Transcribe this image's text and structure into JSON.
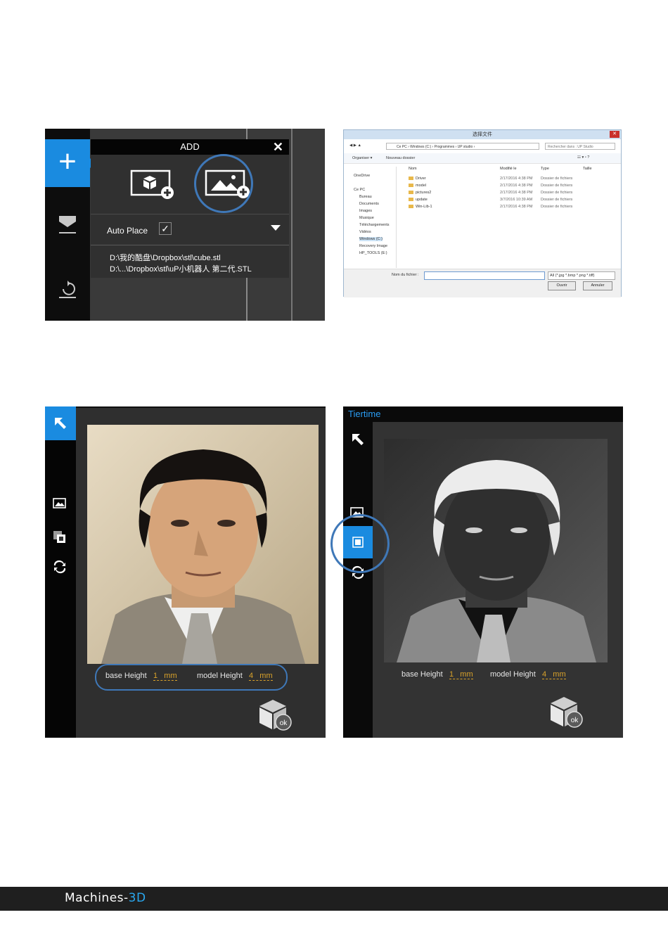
{
  "add_panel": {
    "title": "ADD",
    "close_label": "✕",
    "auto_place_label": "Auto Place",
    "auto_place_checked": true,
    "recent_files": [
      "D:\\我的酷盘\\Dropbox\\stl\\cube.stl",
      "D:\\...\\Dropbox\\stl\\uP小机器人 第二代.STL"
    ],
    "icons": [
      "add-model-icon",
      "add-image-icon",
      "layers-icon",
      "reset-icon"
    ]
  },
  "file_dialog": {
    "title": "选择文件",
    "breadcrumb": "Ce PC  ›  Windows (C:)  ›  Programmes  ›  UP studio  ›",
    "search_placeholder": "Rechercher dans : UP Studio",
    "organize_label": "Organiser ▾",
    "new_folder_label": "Nouveau dossier",
    "columns": [
      "Nom",
      "Modifié le",
      "Type",
      "Taille"
    ],
    "rows": [
      {
        "name": "Driver",
        "date": "2/17/2016 4:38 PM",
        "type": "Dossier de fichiers"
      },
      {
        "name": "model",
        "date": "2/17/2016 4:38 PM",
        "type": "Dossier de fichiers"
      },
      {
        "name": "pictures2",
        "date": "2/17/2016 4:38 PM",
        "type": "Dossier de fichiers"
      },
      {
        "name": "update",
        "date": "3/7/2016 10:39 AM",
        "type": "Dossier de fichiers"
      },
      {
        "name": "Win-Lib-1",
        "date": "2/17/2016 4:38 PM",
        "type": "Dossier de fichiers"
      }
    ],
    "nav_items": [
      "OneDrive",
      "Ce PC",
      "Bureau",
      "Documents",
      "Images",
      "Musique",
      "Téléchargements",
      "Vidéos",
      "Windows (C:)",
      "Recovery Image",
      "HP_TOOLS (E:)"
    ],
    "filename_label": "Nom du fichier :",
    "filetype_value": "All (*.jpg *.bmp *.png *.tiff)",
    "open_label": "Ouvrir",
    "cancel_label": "Annuler"
  },
  "image_panel_left": {
    "base_height_label": "base Height",
    "base_height_value": "1",
    "base_height_unit": "mm",
    "model_height_label": "model Height",
    "model_height_value": "4",
    "model_height_unit": "mm",
    "ok_label": "ok"
  },
  "image_panel_right": {
    "brand": "Tiertime",
    "base_height_label": "base Height",
    "base_height_value": "1",
    "base_height_unit": "mm",
    "model_height_label": "model Height",
    "model_height_value": "4",
    "model_height_unit": "mm",
    "ok_label": "ok"
  },
  "footer": {
    "logo_main": "Machines-",
    "logo_accent": "3D"
  },
  "colors": {
    "accent_blue": "#1a8be0",
    "highlight_circle": "#3f78b8",
    "value_gold": "#d9a22a",
    "footer_bg": "#1f1f1f"
  }
}
